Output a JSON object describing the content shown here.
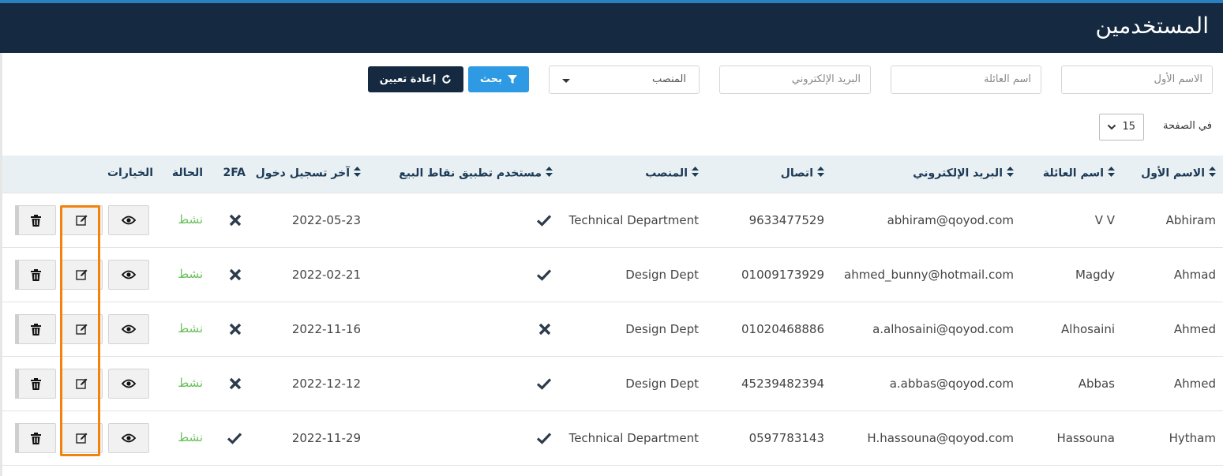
{
  "header": {
    "title": "المستخدمين"
  },
  "filters": {
    "first_name_placeholder": "الاسم الأول",
    "last_name_placeholder": "اسم العائلة",
    "email_placeholder": "البريد الإلكتروني",
    "position_select": "المنصب",
    "search_label": "بحث",
    "reset_label": "إعادة تعيين"
  },
  "pagination": {
    "per_page_label": "في الصفحة",
    "per_page_value": "15"
  },
  "table": {
    "headers": {
      "first_name": "الاسم الأول",
      "last_name": "اسم العائلة",
      "email": "البريد الإلكتروني",
      "phone": "اتصال",
      "position": "المنصب",
      "pos_user": "مستخدم تطبيق نقاط البيع",
      "last_login": "آخر تسجيل دخول",
      "twofa": "2FA",
      "status": "الحالة",
      "options": "الخيارات"
    },
    "rows": [
      {
        "first_name": "Abhiram",
        "last_name": "V V",
        "email": "abhiram@qoyod.com",
        "phone": "9633477529",
        "position": "Technical Department",
        "pos_user": true,
        "last_login": "2022-05-23",
        "twofa": false,
        "status": "نشط"
      },
      {
        "first_name": "Ahmad",
        "last_name": "Magdy",
        "email": "ahmed_bunny@hotmail.com",
        "phone": "01009173929",
        "position": "Design Dept",
        "pos_user": true,
        "last_login": "2022-02-21",
        "twofa": false,
        "status": "نشط"
      },
      {
        "first_name": "Ahmed",
        "last_name": "Alhosaini",
        "email": "a.alhosaini@qoyod.com",
        "phone": "01020468886",
        "position": "Design Dept",
        "pos_user": false,
        "last_login": "2022-11-16",
        "twofa": false,
        "status": "نشط"
      },
      {
        "first_name": "Ahmed",
        "last_name": "Abbas",
        "email": "a.abbas@qoyod.com",
        "phone": "45239482394",
        "position": "Design Dept",
        "pos_user": true,
        "last_login": "2022-12-12",
        "twofa": false,
        "status": "نشط"
      },
      {
        "first_name": "Hytham",
        "last_name": "Hassouna",
        "email": "H.hassouna@qoyod.com",
        "phone": "0597783143",
        "position": "Technical Department",
        "pos_user": true,
        "last_login": "2022-11-29",
        "twofa": true,
        "status": "نشط"
      }
    ]
  },
  "colors": {
    "header_bg": "#152a41",
    "accent_blue": "#2d9ae3",
    "status_green": "#6cc05d",
    "highlight_orange": "#f2820a"
  },
  "icons": {
    "search_button": "filter-icon",
    "reset_button": "refresh-icon",
    "view": "eye-icon",
    "edit": "edit-icon",
    "delete": "trash-icon",
    "yes": "check-icon",
    "no": "x-icon"
  }
}
